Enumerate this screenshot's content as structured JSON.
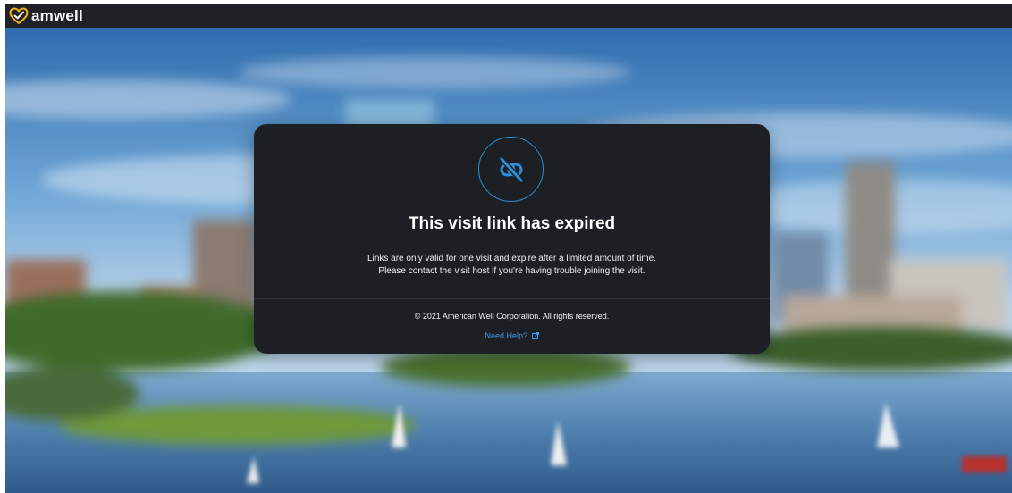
{
  "header": {
    "brand_name": "amwell",
    "logo_icon": "heart-check-logo-icon",
    "accent_color": "#f6b21b"
  },
  "dialog": {
    "icon": "broken-link-icon",
    "icon_color": "#2e8fd8",
    "title": "This visit link has expired",
    "description_line1": "Links are only valid for one visit and expire after a limited amount of time.",
    "description_line2": "Please contact the visit host if you're having trouble joining the visit.",
    "copyright": "© 2021 American Well Corporation. All rights reserved.",
    "help_link": "Need Help?",
    "help_link_icon": "external-link-icon",
    "link_color": "#3d9ae8"
  }
}
